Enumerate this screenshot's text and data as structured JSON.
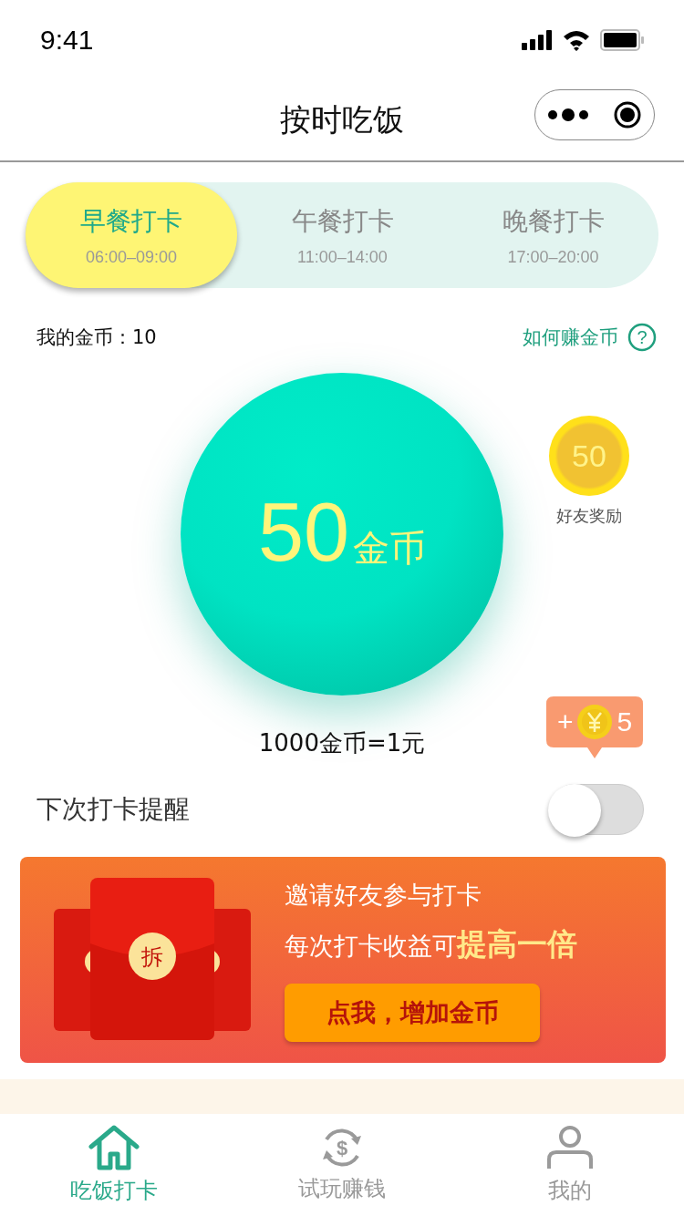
{
  "status_bar": {
    "time": "9:41"
  },
  "nav": {
    "title": "按时吃饭"
  },
  "meal_tabs": [
    {
      "label": "早餐打卡",
      "time": "06:00–09:00",
      "selected": true
    },
    {
      "label": "午餐打卡",
      "time": "11:00–14:00",
      "selected": false
    },
    {
      "label": "晚餐打卡",
      "time": "17:00–20:00",
      "selected": false
    }
  ],
  "coins": {
    "label": "我的金币：10",
    "help_link": "如何赚金币",
    "help_icon": "?"
  },
  "check_in": {
    "amount": "50",
    "unit": "金币"
  },
  "friend_reward": {
    "amount": "50",
    "label": "好友奖励"
  },
  "rate": "1000金币=1元",
  "bonus_bubble": {
    "plus": "+",
    "amount": "5"
  },
  "reminder": {
    "label": "下次打卡提醒",
    "on": false
  },
  "invite_banner": {
    "envelope_mark": "拆",
    "line_1": "邀请好友参与打卡",
    "line_2": "每次打卡收益可**提高一倍**",
    "button": "点我，增加金币"
  },
  "tab_bar": [
    {
      "kind": "home",
      "label": "吃饭打卡",
      "selected": true
    },
    {
      "kind": "money",
      "symbol": "$",
      "label": "试玩赚钱",
      "selected": false
    },
    {
      "kind": "person",
      "label": "我的",
      "selected": false
    }
  ]
}
